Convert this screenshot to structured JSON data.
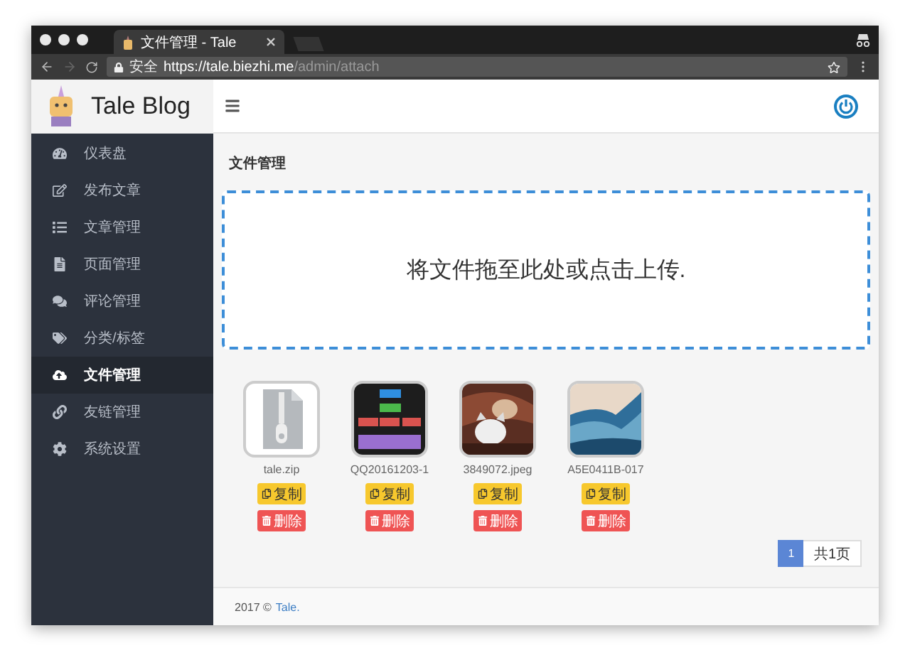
{
  "browser": {
    "tab_title": "文件管理 - Tale",
    "secure_label": "安全",
    "url_host": "https://tale.biezhi.me",
    "url_path": "/admin/attach"
  },
  "brand": {
    "name": "Tale Blog"
  },
  "sidebar": {
    "items": [
      {
        "label": "仪表盘",
        "selected": false
      },
      {
        "label": "发布文章",
        "selected": false
      },
      {
        "label": "文章管理",
        "selected": false
      },
      {
        "label": "页面管理",
        "selected": false
      },
      {
        "label": "评论管理",
        "selected": false
      },
      {
        "label": "分类/标签",
        "selected": false
      },
      {
        "label": "文件管理",
        "selected": true
      },
      {
        "label": "友链管理",
        "selected": false
      },
      {
        "label": "系统设置",
        "selected": false
      }
    ]
  },
  "page_title": "文件管理",
  "dropzone": {
    "text": "将文件拖至此处或点击上传."
  },
  "files": [
    {
      "name": "tale.zip",
      "kind": "zip",
      "copy_label": "复制",
      "delete_label": "删除"
    },
    {
      "name": "QQ20161203-1",
      "kind": "diagram",
      "copy_label": "复制",
      "delete_label": "删除"
    },
    {
      "name": "3849072.jpeg",
      "kind": "cat",
      "copy_label": "复制",
      "delete_label": "删除"
    },
    {
      "name": "A5E0411B-017",
      "kind": "wave",
      "copy_label": "复制",
      "delete_label": "删除"
    }
  ],
  "pagination": {
    "pages": [
      {
        "label": "1",
        "selected": true
      }
    ],
    "total": "共1页"
  },
  "footer": {
    "text": "2017 ©",
    "link": "Tale."
  }
}
